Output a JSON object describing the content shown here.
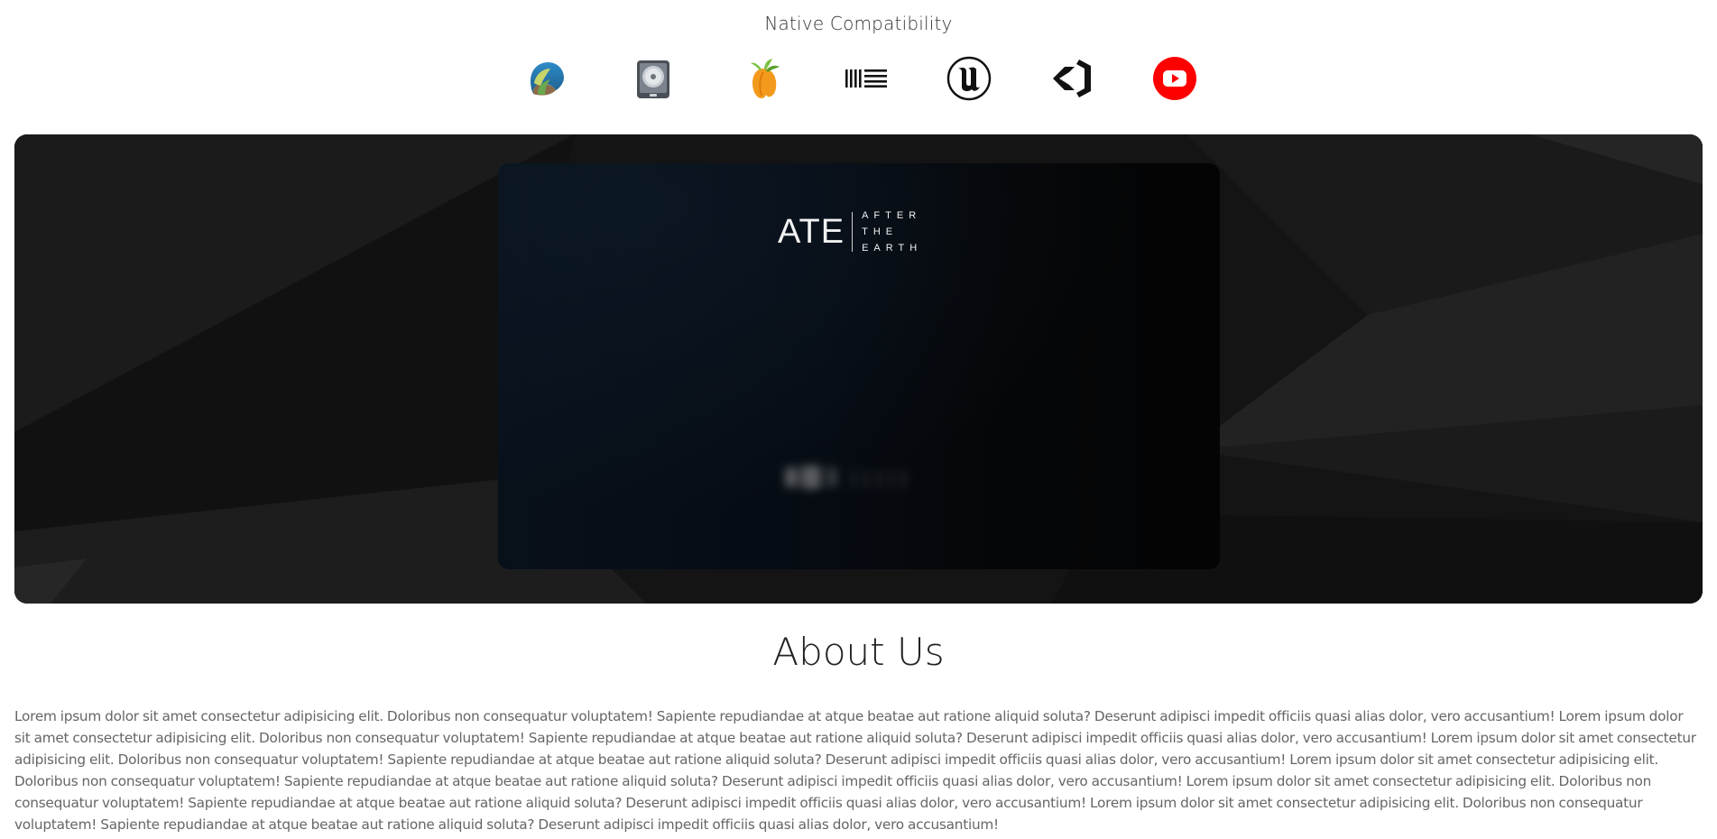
{
  "compatibility": {
    "title": "Native Compatibility",
    "logos": [
      {
        "name": "reaper-icon",
        "label": "REAPER"
      },
      {
        "name": "logic-pro-icon",
        "label": "Logic Pro"
      },
      {
        "name": "fl-studio-icon",
        "label": "FL Studio"
      },
      {
        "name": "ableton-icon",
        "label": "Ableton Live"
      },
      {
        "name": "unreal-engine-icon",
        "label": "Unreal Engine"
      },
      {
        "name": "unity-icon",
        "label": "Unity"
      },
      {
        "name": "youtube-icon",
        "label": "YouTube"
      }
    ]
  },
  "hero": {
    "video_logo_main": "ATE",
    "video_logo_lines": [
      "AFTER",
      "THE",
      "EARTH"
    ]
  },
  "about": {
    "title": "About Us",
    "body": "Lorem ipsum dolor sit amet consectetur adipisicing elit. Doloribus non consequatur voluptatem! Sapiente repudiandae at atque beatae aut ratione aliquid soluta? Deserunt adipisci impedit officiis quasi alias dolor, vero accusantium! Lorem ipsum dolor sit amet consectetur adipisicing elit. Doloribus non consequatur voluptatem! Sapiente repudiandae at atque beatae aut ratione aliquid soluta? Deserunt adipisci impedit officiis quasi alias dolor, vero accusantium! Lorem ipsum dolor sit amet consectetur adipisicing elit. Doloribus non consequatur voluptatem! Sapiente repudiandae at atque beatae aut ratione aliquid soluta? Deserunt adipisci impedit officiis quasi alias dolor, vero accusantium! Lorem ipsum dolor sit amet consectetur adipisicing elit. Doloribus non consequatur voluptatem! Sapiente repudiandae at atque beatae aut ratione aliquid soluta? Deserunt adipisci impedit officiis quasi alias dolor, vero accusantium! Lorem ipsum dolor sit amet consectetur adipisicing elit. Doloribus non consequatur voluptatem! Sapiente repudiandae at atque beatae aut ratione aliquid soluta? Deserunt adipisci impedit officiis quasi alias dolor, vero accusantium! Lorem ipsum dolor sit amet consectetur adipisicing elit. Doloribus non consequatur voluptatem! Sapiente repudiandae at atque beatae aut ratione aliquid soluta? Deserunt adipisci impedit officiis quasi alias dolor, vero accusantium!"
  },
  "colors": {
    "youtube_red": "#ff0000",
    "fl_orange": "#f39a1c",
    "hero_bg": "#151515"
  }
}
